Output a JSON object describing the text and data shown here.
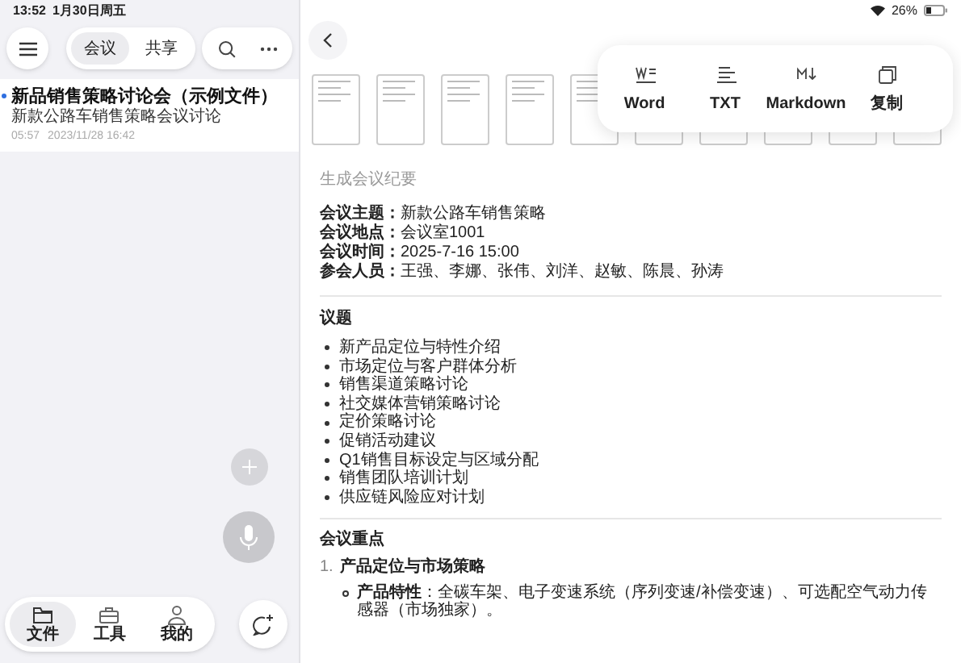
{
  "status_bar": {
    "time": "13:52",
    "date": "1月30日周五",
    "battery": "26%"
  },
  "sidebar": {
    "tabs": [
      {
        "label": "会议",
        "selected": true
      },
      {
        "label": "共享",
        "selected": false
      }
    ],
    "files": [
      {
        "title": "新品销售策略讨论会（示例文件）",
        "subtitle": "新款公路车销售策略会议讨论",
        "duration": "05:57",
        "date": "2023/11/28 16:42",
        "unread": true
      }
    ],
    "nav": [
      {
        "label": "文件",
        "kind": "folder",
        "selected": true
      },
      {
        "label": "工具",
        "kind": "toolbox",
        "selected": false
      },
      {
        "label": "我的",
        "kind": "person",
        "selected": false
      }
    ]
  },
  "export_menu": [
    {
      "label": "Word",
      "kind": "word"
    },
    {
      "label": "TXT",
      "kind": "txt"
    },
    {
      "label": "Markdown",
      "kind": "markdown"
    },
    {
      "label": "复制",
      "kind": "copy"
    }
  ],
  "document": {
    "caption": "生成会议纪要",
    "info": [
      {
        "label": "会议主题：",
        "value": "新款公路车销售策略"
      },
      {
        "label": "会议地点：",
        "value": "会议室1001"
      },
      {
        "label": "会议时间：",
        "value": "2025-7-16 15:00"
      },
      {
        "label": "参会人员：",
        "value": "王强、李娜、张伟、刘洋、赵敏、陈晨、孙涛"
      }
    ],
    "agenda_title": "议题",
    "agenda": [
      "新产品定位与特性介绍",
      "市场定位与客户群体分析",
      "销售渠道策略讨论",
      "社交媒体营销策略讨论",
      "定价策略讨论",
      "促销活动建议",
      "Q1销售目标设定与区域分配",
      "销售团队培训计划",
      "供应链风险应对计划"
    ],
    "highlights_title": "会议重点",
    "highlights": [
      {
        "number": "1.",
        "title": "产品定位与市场策略",
        "points": [
          {
            "label": "产品特性",
            "text": "：全碳车架、电子变速系统（序列变速/补偿变速）、可选配空气动力传感器（市场独家）。"
          }
        ]
      }
    ]
  }
}
